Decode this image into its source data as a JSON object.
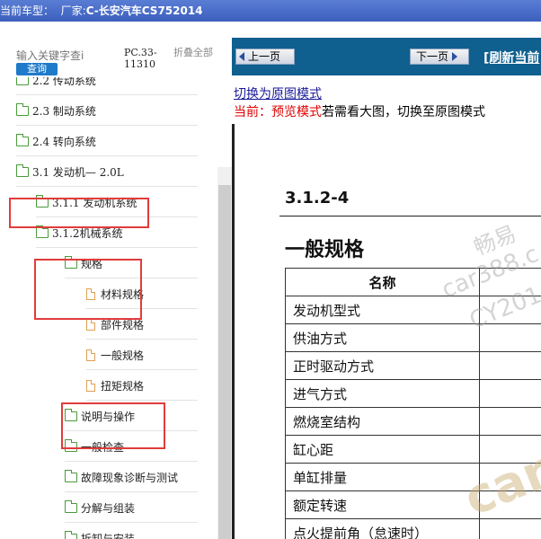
{
  "title_bar": {
    "prefix": "当前车型：",
    "maker_label": "厂家:",
    "model": "C-长安汽车CS752014"
  },
  "search": {
    "placeholder": "输入关键字查i",
    "button": "查询",
    "code_line1": "PC.33-",
    "code_line2": "11310",
    "collapse": "折叠全部"
  },
  "tree": [
    {
      "label": "2.2 传动系统",
      "icon": "folder-icon",
      "level": 0
    },
    {
      "label": "2.3 制动系统",
      "icon": "folder-icon",
      "level": 0
    },
    {
      "label": "2.4 转向系统",
      "icon": "folder-icon",
      "level": 0
    },
    {
      "label": "3.1 发动机— 2.0L",
      "icon": "folder-open-icon",
      "level": 0
    },
    {
      "label": "3.1.1 发动机系统",
      "icon": "folder-icon",
      "level": 1
    },
    {
      "label": "3.1.2机械系统",
      "icon": "folder-open-icon",
      "level": 1
    },
    {
      "label": "规格",
      "icon": "folder-open-icon",
      "level": 2
    },
    {
      "label": "材料规格",
      "icon": "document-icon",
      "level": 3
    },
    {
      "label": "部件规格",
      "icon": "document-icon",
      "level": 3
    },
    {
      "label": "一般规格",
      "icon": "document-icon",
      "level": 3
    },
    {
      "label": "扭矩规格",
      "icon": "document-icon",
      "level": 3
    },
    {
      "label": "说明与操作",
      "icon": "folder-icon",
      "level": 2
    },
    {
      "label": "一般检查",
      "icon": "folder-icon",
      "level": 2
    },
    {
      "label": "故障现象诊断与测试",
      "icon": "folder-icon",
      "level": 2
    },
    {
      "label": "分解与组装",
      "icon": "folder-icon",
      "level": 2
    },
    {
      "label": "拆卸与安装",
      "icon": "folder-icon",
      "level": 2
    }
  ],
  "nav": {
    "prev": "上一页",
    "next": "下一页",
    "refresh": "[刷新当前"
  },
  "view": {
    "switch_link": "切换为原图模式",
    "current_label": "当前：",
    "mode": "预览模式",
    "hint": "若需看大图，切换至原图模式"
  },
  "document": {
    "section": "3.1.2-4",
    "title": "一般规格",
    "table_header": "名称",
    "rows": [
      "发动机型式",
      "供油方式",
      "正时驱动方式",
      "进气方式",
      "燃烧室结构",
      "缸心距",
      "单缸排量",
      "额定转速",
      "点火提前角（怠速时）"
    ]
  },
  "watermark": {
    "line1": "畅易",
    "line2": "car388.c",
    "line3": "CY201",
    "line4": "car"
  },
  "colors": {
    "nav_bg": "#0f5f8f",
    "highlight": "#e23b3b",
    "link": "#1a1a9a"
  }
}
